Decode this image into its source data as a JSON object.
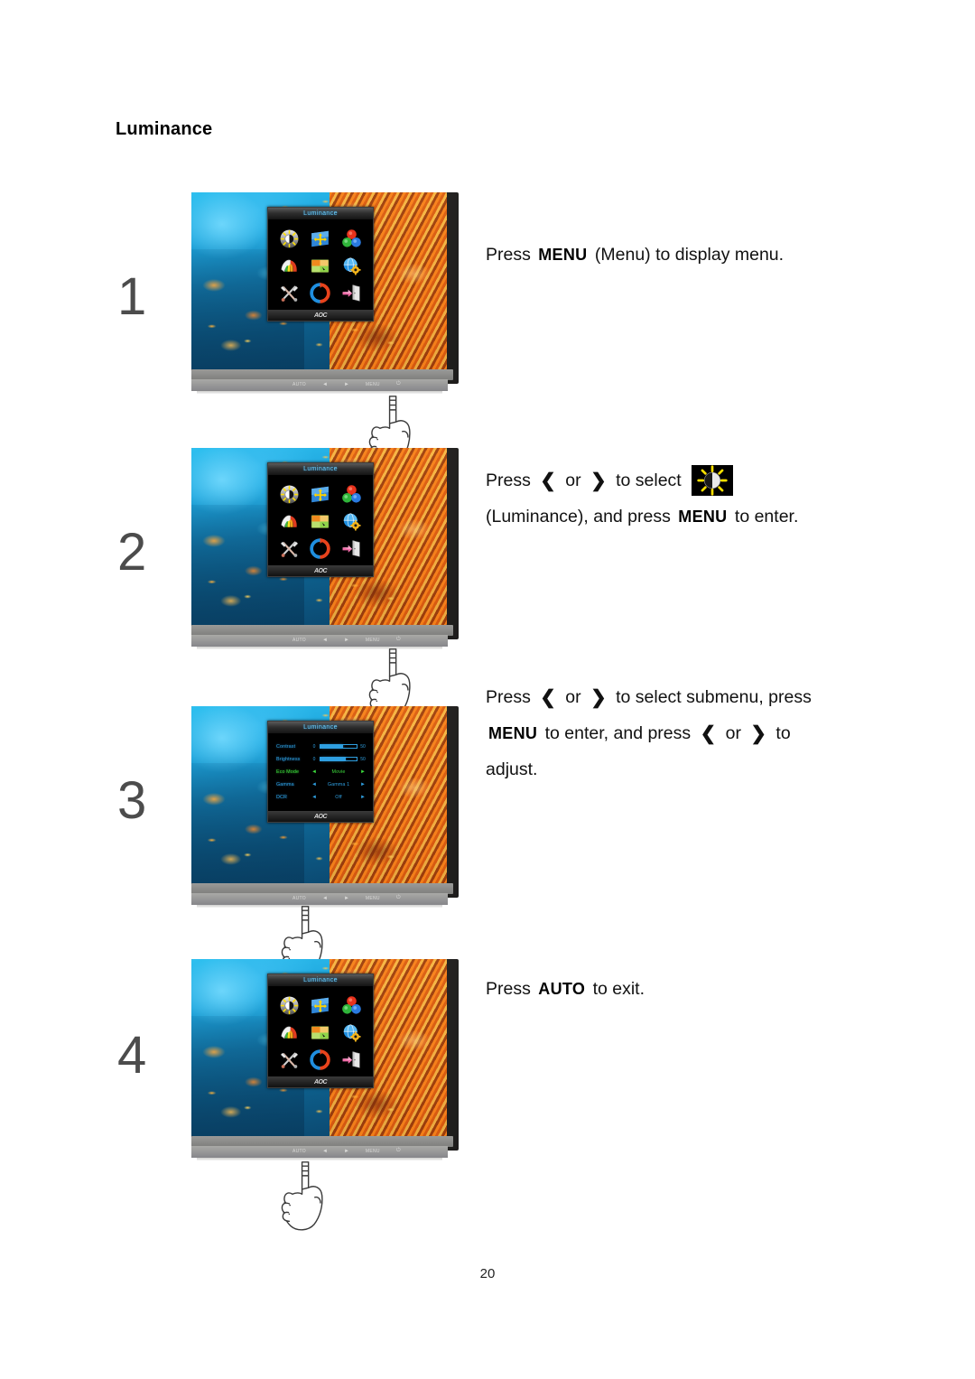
{
  "document": {
    "section_title": "Luminance",
    "page_number": "20"
  },
  "keys": {
    "menu": "MENU",
    "auto": "AUTO",
    "left_arrow": "❮",
    "right_arrow": "❯",
    "or": "or"
  },
  "monitor": {
    "brand_logo": "AOC",
    "osd_title": "Luminance",
    "bezel_buttons": [
      {
        "name": "auto-button",
        "label": "AUTO"
      },
      {
        "name": "left-button",
        "label": "◄"
      },
      {
        "name": "right-button",
        "label": "►"
      },
      {
        "name": "menu-button",
        "label": "MENU"
      },
      {
        "name": "power-button",
        "label": "⏻"
      }
    ],
    "osd_icons": [
      {
        "name": "luminance-icon",
        "label": "Luminance"
      },
      {
        "name": "image-setup-icon",
        "label": "Image Setup"
      },
      {
        "name": "color-setup-icon",
        "label": "Color Setup"
      },
      {
        "name": "picture-boost-icon",
        "label": "Picture Boost"
      },
      {
        "name": "osd-setup-icon",
        "label": "OSD Setup"
      },
      {
        "name": "language-icon",
        "label": "Language"
      },
      {
        "name": "extra-tools-icon",
        "label": "Extra"
      },
      {
        "name": "reset-icon",
        "label": "Reset"
      },
      {
        "name": "exit-icon",
        "label": "Exit"
      }
    ],
    "luminance_submenu": [
      {
        "label": "Contrast",
        "type": "slider",
        "min": "0",
        "value": "50",
        "fill": 62,
        "active": false
      },
      {
        "label": "Brightness",
        "type": "slider",
        "min": "0",
        "value": "50",
        "fill": 70,
        "active": false
      },
      {
        "label": "Eco Mode",
        "type": "option",
        "value": "Movie",
        "active": true
      },
      {
        "label": "Gamma",
        "type": "option",
        "value": "Gamma 1",
        "active": false
      },
      {
        "label": "DCR",
        "type": "option",
        "value": "Off",
        "active": false
      }
    ]
  },
  "steps": [
    {
      "number": "1",
      "lines": [
        [
          {
            "t": "text",
            "v": "Press"
          },
          {
            "t": "key",
            "v": "MENU"
          },
          {
            "t": "text",
            "v": "(Menu) to display menu."
          }
        ]
      ]
    },
    {
      "number": "2",
      "lines": [
        [
          {
            "t": "text",
            "v": "Press"
          },
          {
            "t": "chev",
            "v": "❮"
          },
          {
            "t": "text",
            "v": "or"
          },
          {
            "t": "chev",
            "v": "❯"
          },
          {
            "t": "text",
            "v": "to select"
          },
          {
            "t": "chip",
            "v": "luminance-icon"
          }
        ],
        [
          {
            "t": "text",
            "v": "(Luminance), and press"
          },
          {
            "t": "key",
            "v": "MENU"
          },
          {
            "t": "text",
            "v": "to enter."
          }
        ]
      ]
    },
    {
      "number": "3",
      "lines": [
        [
          {
            "t": "text",
            "v": "Press"
          },
          {
            "t": "chev",
            "v": "❮"
          },
          {
            "t": "text",
            "v": "or"
          },
          {
            "t": "chev",
            "v": "❯"
          },
          {
            "t": "text",
            "v": "to select submenu, press"
          }
        ],
        [
          {
            "t": "key",
            "v": "MENU"
          },
          {
            "t": "text",
            "v": "to enter, and press"
          },
          {
            "t": "chev",
            "v": "❮"
          },
          {
            "t": "text",
            "v": "or"
          },
          {
            "t": "chev",
            "v": "❯"
          },
          {
            "t": "text",
            "v": "to"
          }
        ],
        [
          {
            "t": "text",
            "v": "adjust."
          }
        ]
      ]
    },
    {
      "number": "4",
      "lines": [
        [
          {
            "t": "text",
            "v": "Press"
          },
          {
            "t": "key",
            "v": "AUTO"
          },
          {
            "t": "text",
            "v": "to exit."
          }
        ]
      ]
    }
  ],
  "colors": {
    "osd_title_text": "#6fd0ff",
    "osd_label_blue": "#2f9fe0",
    "osd_active_green": "#3ddc3d",
    "sun_yellow": "#ffe000",
    "page_bg": "#ffffff"
  }
}
